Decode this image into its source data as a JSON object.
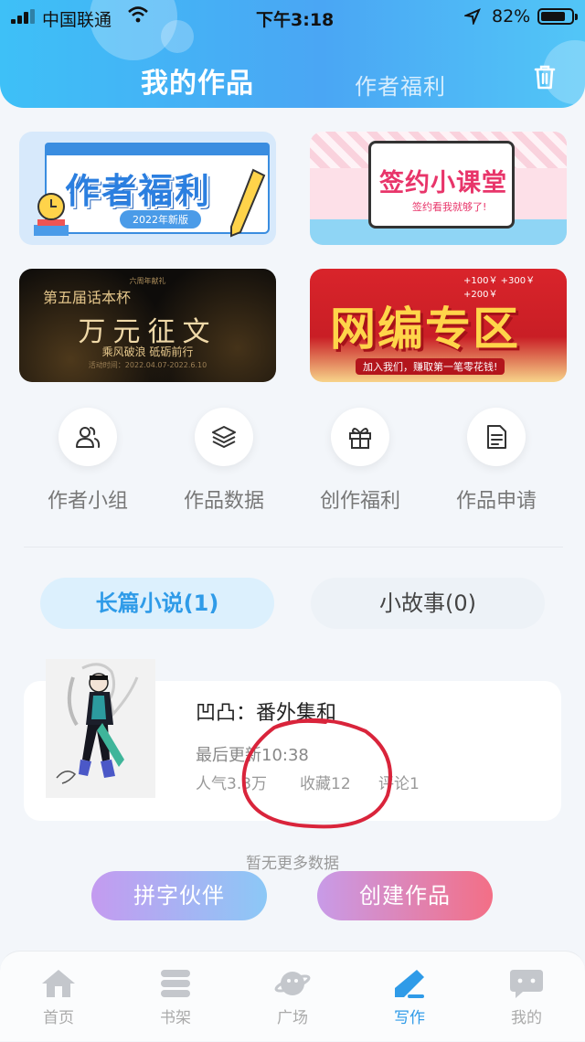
{
  "status_bar": {
    "carrier": "中国联通",
    "time": "下午3:18",
    "battery": "82%",
    "battery_level": 0.82
  },
  "header": {
    "tab_active": "我的作品",
    "tab_other": "作者福利"
  },
  "banners": [
    {
      "title": "作者福利",
      "subtitle": "2022年新版"
    },
    {
      "title": "签约小课堂",
      "subtitle": "签约看我就够了!"
    },
    {
      "top": "六周年献礼",
      "title_small": "第五届话本杯",
      "title": "万元征文",
      "subtitle": "乘风破浪 砥砺前行",
      "dates": "活动时间：2022.04.07-2022.6.10"
    },
    {
      "title": "网编专区",
      "subtitle": "加入我们，赚取第一笔零花钱!",
      "money": "+100￥  +300￥  +200￥"
    }
  ],
  "quick_nav": [
    {
      "label": "作者小组",
      "icon": "users-icon"
    },
    {
      "label": "作品数据",
      "icon": "layers-icon"
    },
    {
      "label": "创作福利",
      "icon": "gift-icon"
    },
    {
      "label": "作品申请",
      "icon": "document-icon"
    }
  ],
  "work_tabs": {
    "long": "长篇小说(1)",
    "short": "小故事(0)"
  },
  "work": {
    "title": "凹凸：番外集和",
    "last_update": "最后更新10:38",
    "popularity": "人气3.3万",
    "favorites": "收藏12",
    "comments": "评论1"
  },
  "no_more": "暂无更多数据",
  "buttons": {
    "partner": "拼字伙伴",
    "create": "创建作品"
  },
  "tabbar": [
    {
      "label": "首页",
      "icon": "home-icon"
    },
    {
      "label": "书架",
      "icon": "bookshelf-icon"
    },
    {
      "label": "广场",
      "icon": "planet-icon"
    },
    {
      "label": "写作",
      "icon": "pen-icon",
      "active": true
    },
    {
      "label": "我的",
      "icon": "chat-bubble-icon"
    }
  ],
  "colors": {
    "accent": "#2f9be8",
    "header": "#3ec0f7",
    "annotation": "#d9243b"
  }
}
